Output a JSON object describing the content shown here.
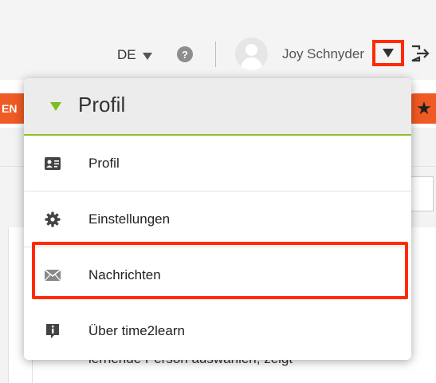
{
  "header": {
    "language": "DE",
    "language_caret_icon": "triangle-down-icon",
    "help_icon": "question-circle-icon",
    "help_glyph": "?",
    "username": "Joy Schnyder",
    "avatar_icon": "user-avatar-icon",
    "user_menu_icon": "triangle-down-icon",
    "logout_icon": "logout-icon"
  },
  "background": {
    "left_tab_text": "EN",
    "right_tab_icon": "star-icon",
    "right_tab_glyph": "★",
    "snippet_text": "lernende Person auswählen, zeigt"
  },
  "dropdown": {
    "title": "Profil",
    "items": [
      {
        "label": "Profil",
        "icon": "id-card-icon"
      },
      {
        "label": "Einstellungen",
        "icon": "gear-icon"
      },
      {
        "label": "Nachrichten",
        "icon": "envelope-icon"
      },
      {
        "label": "Über time2learn",
        "icon": "info-icon"
      }
    ],
    "highlighted_item": "Nachrichten"
  },
  "colors": {
    "accent_green": "#8cbf26",
    "accent_orange": "#f05a24",
    "highlight_red": "#ff2a00"
  }
}
